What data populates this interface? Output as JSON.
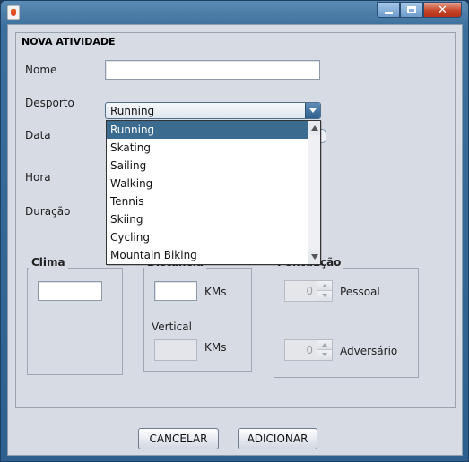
{
  "window": {
    "title": "",
    "controls": {
      "minimize": "minimize",
      "maximize": "maximize",
      "close": "✕"
    }
  },
  "form": {
    "panel_title": "NOVA ATIVIDADE",
    "nome": {
      "label": "Nome",
      "value": ""
    },
    "desporto": {
      "label": "Desporto",
      "selected": "Running",
      "options": [
        "Running",
        "Skating",
        "Sailing",
        "Walking",
        "Tennis",
        "Skiing",
        "Cycling",
        "Mountain Biking"
      ],
      "selected_index": 0
    },
    "data": {
      "label": "Data"
    },
    "hora": {
      "label": "Hora"
    },
    "duracao": {
      "label": "Duração"
    }
  },
  "clima": {
    "title": "Clima",
    "value": ""
  },
  "distancia": {
    "title": "Distância",
    "value": "",
    "unit": "KMs",
    "vertical_label": "Vertical",
    "vertical_value": "",
    "vertical_unit": "KMs"
  },
  "pontuacao": {
    "title": "Pontuação",
    "pessoal": {
      "label": "Pessoal",
      "value": "0"
    },
    "adversario": {
      "label": "Adversário",
      "value": "0"
    }
  },
  "buttons": {
    "cancel": "CANCELAR",
    "add": "ADICIONAR"
  },
  "colors": {
    "selection": "#3b6b8f",
    "titlebar": "#3c6f9c",
    "close": "#c4452a"
  }
}
